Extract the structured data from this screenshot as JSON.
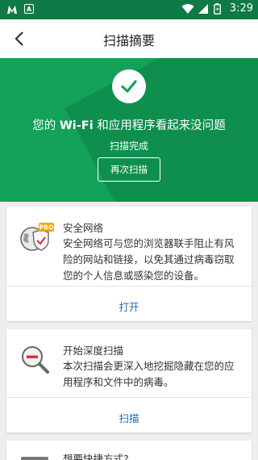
{
  "status_bar": {
    "time": "3:29",
    "colors": {
      "background": "#0e7a45"
    }
  },
  "header": {
    "title": "扫描摘要"
  },
  "hero": {
    "title_pre": "您的",
    "title_wifi": "Wi-Fi",
    "title_post": "和应用程序看起来没问题",
    "subtitle": "扫描完成",
    "rescan_label": "再次扫描",
    "colors": {
      "background": "#14a15a",
      "shade": "#0f8f4e"
    }
  },
  "cards": [
    {
      "icon": "secure-browsing-pro-icon",
      "badge": "PRO",
      "title": "安全网络",
      "description": "安全网络可与您的浏览器联手阻止有风险的网站和链接，以免其通过病毒窃取您的个人信息或感染您的设备。",
      "action": "打开"
    },
    {
      "icon": "deep-scan-magnifier-icon",
      "title": "开始深度扫描",
      "description": "本次扫描会更深入地挖掘隐藏在您的应用程序和文件中的病毒。",
      "action": "扫描"
    },
    {
      "icon": "shortcut-icon",
      "title": "想要快捷方式?"
    }
  ],
  "colors": {
    "accent_link": "#1a6fc0"
  }
}
